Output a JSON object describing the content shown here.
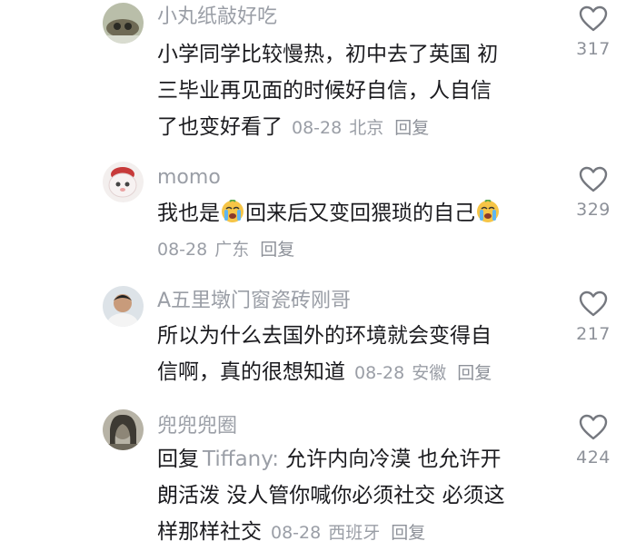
{
  "comments": [
    {
      "username": "小丸纸敲好吃",
      "text_lines": [
        "小学同学比较慢热，初中去了英国 初",
        "三毕业再见面的时候好自信，人自信",
        "了也变好看了"
      ],
      "date": "08-28",
      "location": "北京",
      "reply_label": "回复",
      "likes": "317",
      "avatar": "avatar-user-1"
    },
    {
      "username": "momo",
      "text_before": "我也是",
      "text_middle": "回来后又变回猥琐的自己",
      "emoji": "crying-face-emoji",
      "date": "08-28",
      "location": "广东",
      "reply_label": "回复",
      "likes": "329",
      "avatar": "avatar-user-2"
    },
    {
      "username": "A五里墩门窗瓷砖刚哥",
      "text_lines": [
        "所以为什么去国外的环境就会变得自",
        "信啊，真的很想知道"
      ],
      "date": "08-28",
      "location": "安徽",
      "reply_label": "回复",
      "likes": "217",
      "avatar": "avatar-user-3"
    },
    {
      "username": "兜兜兜圈",
      "reply_prefix": "回复",
      "reply_target": "Tiffany:",
      "text_lines": [
        " 允许内向冷漠 也允许开",
        "朗活泼 没人管你喊你必须社交 必须这",
        "样那样社交"
      ],
      "date": "08-28",
      "location": "西班牙",
      "reply_label": "回复",
      "likes": "424",
      "avatar": "avatar-user-4"
    }
  ],
  "icons": {
    "like": "heart-outline-icon"
  },
  "colors": {
    "text": "#1b1b1f",
    "muted": "#9a9ea6"
  }
}
